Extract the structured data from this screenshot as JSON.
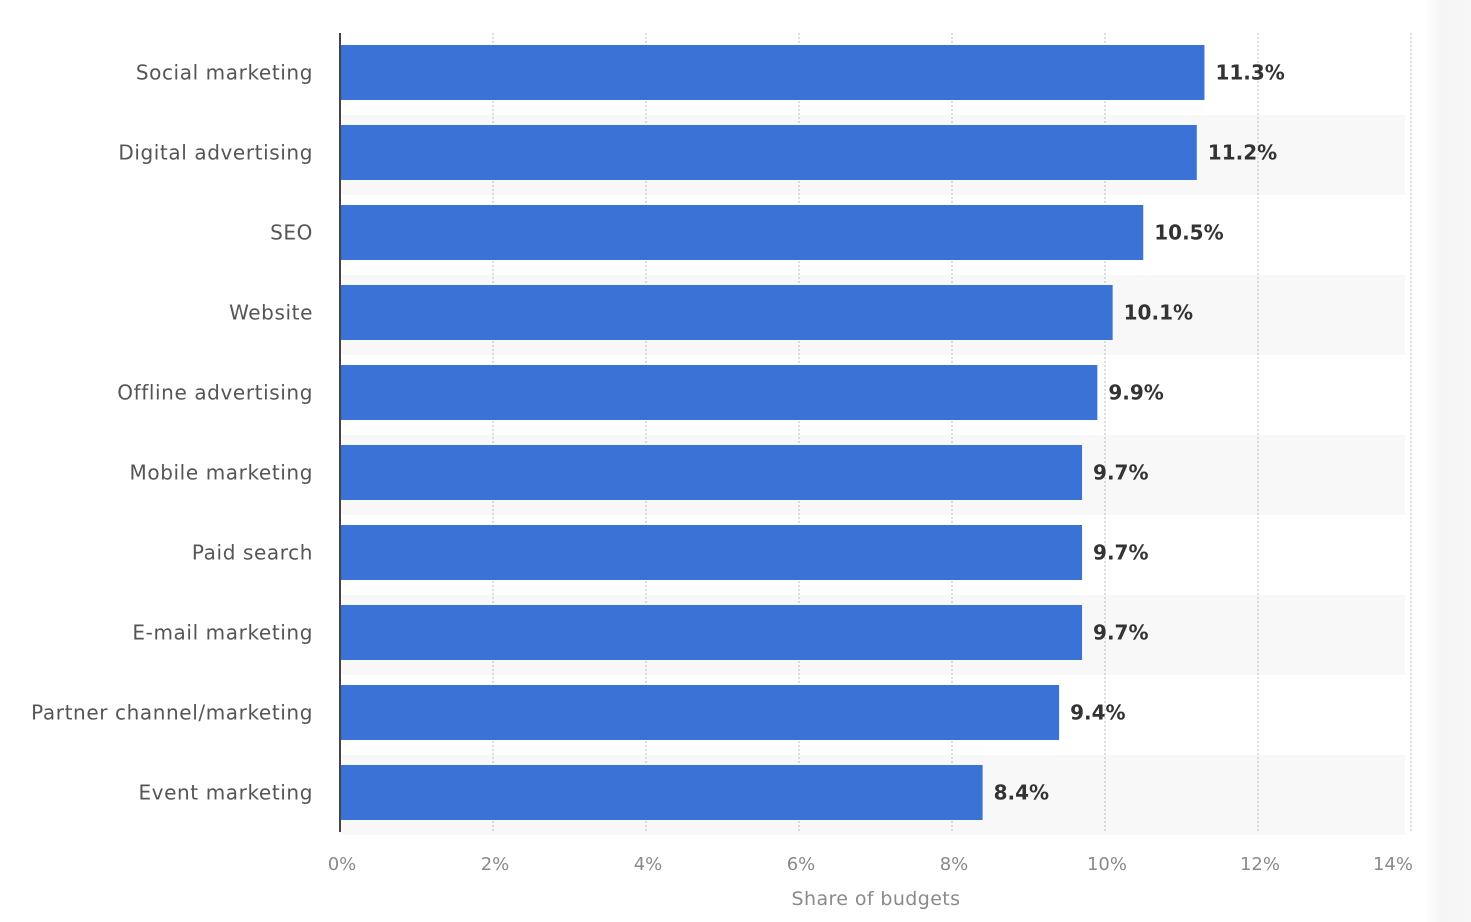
{
  "chart_data": {
    "type": "bar",
    "orientation": "horizontal",
    "title": "",
    "xlabel": "Share of budgets",
    "ylabel": "",
    "xlim": [
      0,
      14
    ],
    "x_ticks": [
      0,
      2,
      4,
      6,
      8,
      10,
      12,
      14
    ],
    "x_tick_labels": [
      "0%",
      "2%",
      "4%",
      "6%",
      "8%",
      "10%",
      "12%",
      "14%"
    ],
    "grid": "vertical dotted",
    "legend": "none",
    "categories": [
      "Social marketing",
      "Digital advertising",
      "SEO",
      "Website",
      "Offline advertising",
      "Mobile marketing",
      "Paid search",
      "E-mail marketing",
      "Partner channel/marketing",
      "Event marketing"
    ],
    "values": [
      11.3,
      11.2,
      10.5,
      10.1,
      9.9,
      9.7,
      9.7,
      9.7,
      9.4,
      8.4
    ],
    "value_labels": [
      "11.3%",
      "11.2%",
      "10.5%",
      "10.1%",
      "9.9%",
      "9.7%",
      "9.7%",
      "9.7%",
      "9.4%",
      "8.4%"
    ],
    "unit": "%",
    "colors": {
      "bar": "#3a73d5",
      "band": "#f8f8f8",
      "axis": "#444444"
    }
  }
}
